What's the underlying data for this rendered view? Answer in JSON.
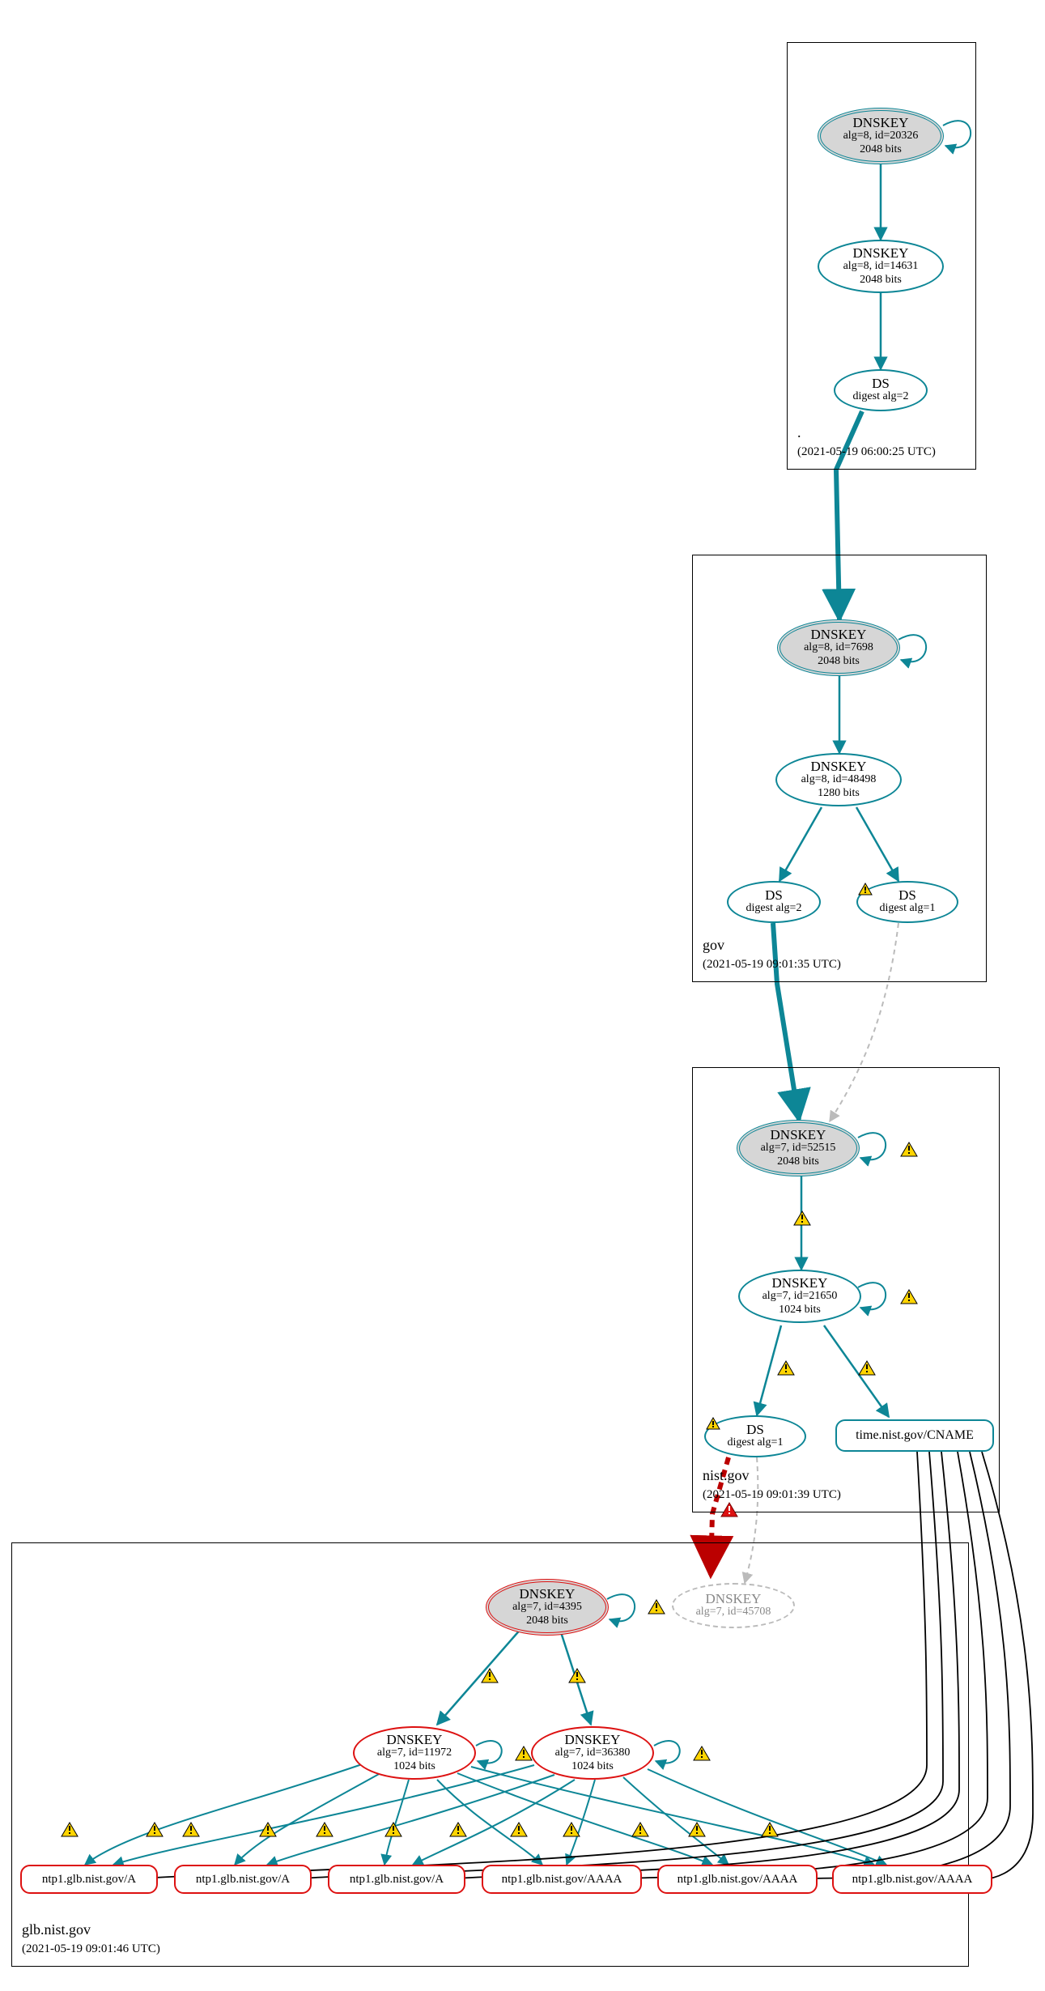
{
  "zones": {
    "root": {
      "name": ".",
      "ts": "(2021-05-19 06:00:25 UTC)"
    },
    "gov": {
      "name": "gov",
      "ts": "(2021-05-19 09:01:35 UTC)"
    },
    "nist": {
      "name": "nist.gov",
      "ts": "(2021-05-19 09:01:39 UTC)"
    },
    "glb": {
      "name": "glb.nist.gov",
      "ts": "(2021-05-19 09:01:46 UTC)"
    }
  },
  "root": {
    "ksk": {
      "t": "DNSKEY",
      "l1": "alg=8, id=20326",
      "l2": "2048 bits"
    },
    "zsk": {
      "t": "DNSKEY",
      "l1": "alg=8, id=14631",
      "l2": "2048 bits"
    },
    "ds": {
      "t": "DS",
      "l1": "digest alg=2"
    }
  },
  "gov": {
    "ksk": {
      "t": "DNSKEY",
      "l1": "alg=8, id=7698",
      "l2": "2048 bits"
    },
    "zsk": {
      "t": "DNSKEY",
      "l1": "alg=8, id=48498",
      "l2": "1280 bits"
    },
    "ds1": {
      "t": "DS",
      "l1": "digest alg=2"
    },
    "ds2": {
      "t": "DS",
      "l1": "digest alg=1"
    }
  },
  "nist": {
    "ksk": {
      "t": "DNSKEY",
      "l1": "alg=7, id=52515",
      "l2": "2048 bits"
    },
    "zsk": {
      "t": "DNSKEY",
      "l1": "alg=7, id=21650",
      "l2": "1024 bits"
    },
    "ds": {
      "t": "DS",
      "l1": "digest alg=1"
    },
    "cname": {
      "t": "time.nist.gov/CNAME"
    }
  },
  "glb": {
    "ksk": {
      "t": "DNSKEY",
      "l1": "alg=7, id=4395",
      "l2": "2048 bits"
    },
    "ghost": {
      "t": "DNSKEY",
      "l1": "alg=7, id=45708"
    },
    "zsk1": {
      "t": "DNSKEY",
      "l1": "alg=7, id=11972",
      "l2": "1024 bits"
    },
    "zsk2": {
      "t": "DNSKEY",
      "l1": "alg=7, id=36380",
      "l2": "1024 bits"
    },
    "rr": [
      "ntp1.glb.nist.gov/A",
      "ntp1.glb.nist.gov/A",
      "ntp1.glb.nist.gov/A",
      "ntp1.glb.nist.gov/AAAA",
      "ntp1.glb.nist.gov/AAAA",
      "ntp1.glb.nist.gov/AAAA"
    ]
  }
}
